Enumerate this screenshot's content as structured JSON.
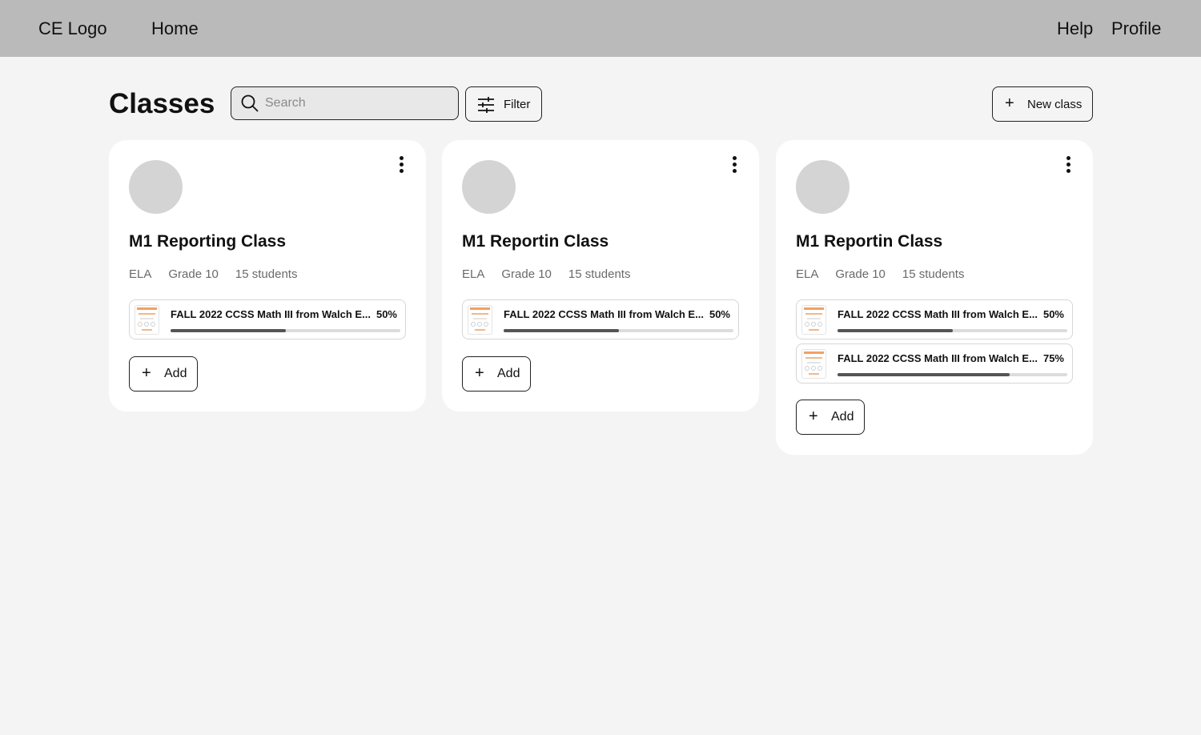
{
  "nav": {
    "logo": "CE Logo",
    "home": "Home",
    "help": "Help",
    "profile": "Profile"
  },
  "page": {
    "title": "Classes"
  },
  "toolbar": {
    "search_placeholder": "Search",
    "filter_label": "Filter",
    "new_class_label": "New class"
  },
  "cards": [
    {
      "name": "M1 Reporting Class",
      "subject": "ELA",
      "grade": "Grade 10",
      "students": "15 students",
      "add_label": "Add",
      "resources": [
        {
          "title": "FALL 2022 CCSS Math III from Walch E...",
          "percent_label": "50%",
          "progress": 0.5
        }
      ]
    },
    {
      "name": "M1 Reportin Class",
      "subject": "ELA",
      "grade": "Grade 10",
      "students": "15 students",
      "add_label": "Add",
      "resources": [
        {
          "title": "FALL 2022 CCSS Math III from Walch E...",
          "percent_label": "50%",
          "progress": 0.5
        }
      ]
    },
    {
      "name": "M1 Reportin Class",
      "subject": "ELA",
      "grade": "Grade 10",
      "students": "15 students",
      "add_label": "Add",
      "resources": [
        {
          "title": "FALL 2022 CCSS Math III from Walch E...",
          "percent_label": "50%",
          "progress": 0.5
        },
        {
          "title": "FALL 2022 CCSS Math III from Walch E...",
          "percent_label": "75%",
          "progress": 0.75
        }
      ]
    }
  ],
  "colors": {
    "page_bg": "#f4f4f4",
    "topbar_bg": "#bababa",
    "card_bg": "#ffffff",
    "avatar": "#d4d4d4",
    "progress_fill": "#555555",
    "progress_track": "#dcdcdc",
    "thumb_accent": "#f2a062"
  }
}
